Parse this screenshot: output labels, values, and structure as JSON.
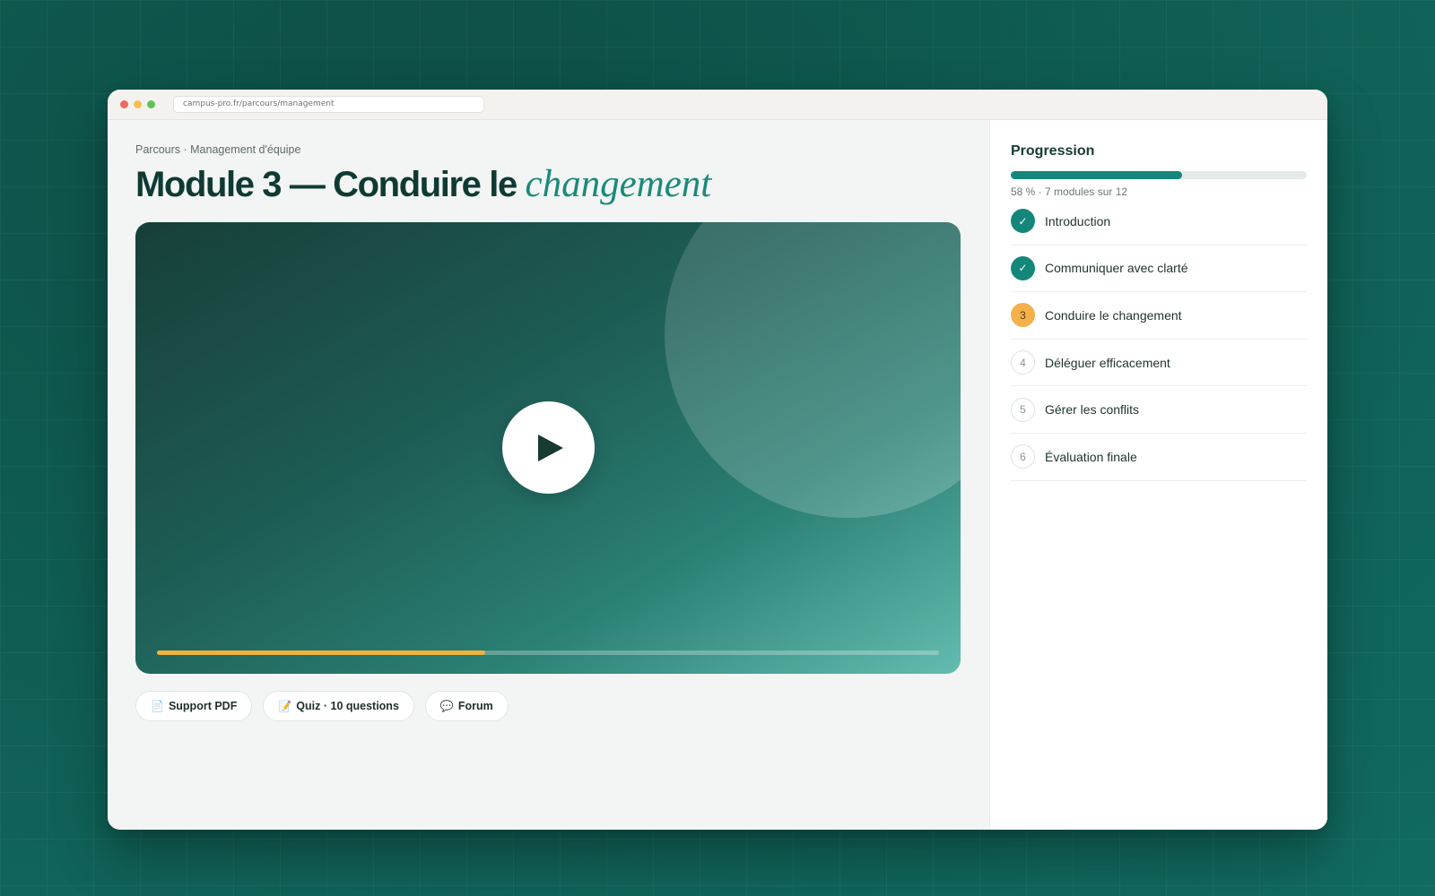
{
  "browser": {
    "url": "campus-pro.fr/parcours/management"
  },
  "course": {
    "breadcrumb": "Parcours · Management d'équipe",
    "title_main": "Module 3 — Conduire le ",
    "title_accent": "changement"
  },
  "video": {
    "progress": 0.42,
    "progress_color": "#f0b23c"
  },
  "resources": [
    {
      "icon": "📄",
      "icon_name": "document-icon",
      "label": "Support PDF"
    },
    {
      "icon": "📝",
      "icon_name": "memo-icon",
      "label": "Quiz · 10 questions"
    },
    {
      "icon": "💬",
      "icon_name": "speech-bubble-icon",
      "label": "Forum"
    }
  ],
  "progression": {
    "title": "Progression",
    "percent": 58,
    "summary": "58 % · 7 modules sur 12",
    "modules": [
      {
        "status": "done",
        "badge": "✓",
        "label": "Introduction"
      },
      {
        "status": "done",
        "badge": "✓",
        "label": "Communiquer avec clarté"
      },
      {
        "status": "current",
        "badge": "3",
        "label": "Conduire le changement"
      },
      {
        "status": "todo",
        "badge": "4",
        "label": "Déléguer efficacement"
      },
      {
        "status": "todo",
        "badge": "5",
        "label": "Gérer les conflits"
      },
      {
        "status": "todo",
        "badge": "6",
        "label": "Évaluation finale"
      }
    ]
  },
  "colors": {
    "accent": "#14877a",
    "current": "#f4b04a",
    "title": "#0e3a33"
  }
}
